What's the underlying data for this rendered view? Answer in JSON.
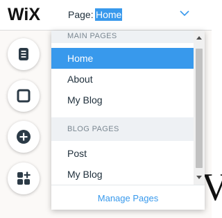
{
  "app": {
    "logo": "WiX"
  },
  "page_selector": {
    "label": "Page:",
    "current": "Home",
    "chevron_icon": "chevron-down-icon"
  },
  "dropdown": {
    "sections": [
      {
        "header": "MAIN PAGES",
        "items": [
          {
            "label": "Home",
            "selected": true
          },
          {
            "label": "About",
            "selected": false
          },
          {
            "label": "My Blog",
            "selected": false
          }
        ]
      },
      {
        "header": "BLOG PAGES",
        "items": [
          {
            "label": "Post",
            "selected": false
          },
          {
            "label": "My Blog",
            "selected": false
          }
        ]
      }
    ],
    "footer_link": "Manage Pages"
  },
  "side_toolbar": [
    {
      "name": "pages-menu-button",
      "icon": "document-icon"
    },
    {
      "name": "background-button",
      "icon": "square-icon"
    },
    {
      "name": "add-button",
      "icon": "plus-circle-icon"
    },
    {
      "name": "add-apps-button",
      "icon": "apps-plus-icon"
    }
  ],
  "colors": {
    "accent": "#3899ec",
    "text": "#20303c",
    "section_bg": "#eef1f4",
    "section_text": "#7a8791"
  }
}
